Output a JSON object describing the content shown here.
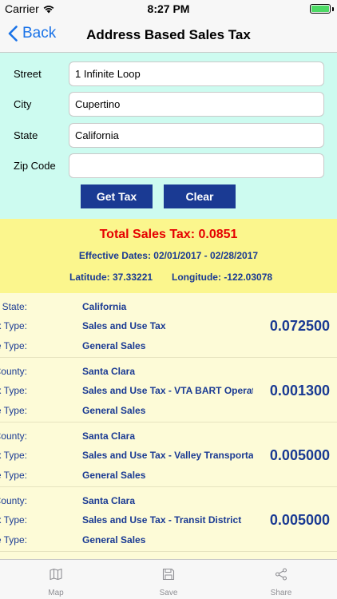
{
  "status_bar": {
    "carrier": "Carrier",
    "time": "8:27 PM"
  },
  "nav": {
    "back_label": "Back",
    "title": "Address Based Sales Tax"
  },
  "form": {
    "fields": [
      {
        "label": "Street",
        "value": "1 Infinite Loop"
      },
      {
        "label": "City",
        "value": "Cupertino"
      },
      {
        "label": "State",
        "value": "California"
      },
      {
        "label": "Zip Code",
        "value": ""
      }
    ],
    "get_tax_label": "Get Tax",
    "clear_label": "Clear"
  },
  "summary": {
    "total": "Total Sales Tax: 0.0851",
    "effective_dates": "Effective Dates: 02/01/2017 - 02/28/2017",
    "latitude": "Latitude: 37.33221",
    "longitude": "Longitude: -122.03078"
  },
  "entries": [
    {
      "jurisdiction_label": "State:",
      "jurisdiction": "California",
      "tax_type_label": "Tax Type:",
      "tax_type": "Sales and Use Tax",
      "rate_type_label": "Rate Type:",
      "rate_type": "General Sales",
      "rate": "0.072500"
    },
    {
      "jurisdiction_label": "County:",
      "jurisdiction": "Santa Clara",
      "tax_type_label": "Tax Type:",
      "tax_type": "Sales and Use Tax - VTA BART Operating",
      "rate_type_label": "Rate Type:",
      "rate_type": "General Sales",
      "rate": "0.001300"
    },
    {
      "jurisdiction_label": "County:",
      "jurisdiction": "Santa Clara",
      "tax_type_label": "Tax Type:",
      "tax_type": "Sales and Use Tax - Valley Transportation",
      "rate_type_label": "Rate Type:",
      "rate_type": "General Sales",
      "rate": "0.005000"
    },
    {
      "jurisdiction_label": "County:",
      "jurisdiction": "Santa Clara",
      "tax_type_label": "Tax Type:",
      "tax_type": "Sales and Use Tax - Transit District",
      "rate_type_label": "Rate Type:",
      "rate_type": "General Sales",
      "rate": "0.005000"
    }
  ],
  "tab_bar": {
    "tabs": [
      {
        "label": "Map",
        "icon": "map-icon"
      },
      {
        "label": "Save",
        "icon": "save-icon"
      },
      {
        "label": "Share",
        "icon": "share-icon"
      }
    ]
  },
  "colors": {
    "form_background": "#cdfbf0",
    "summary_background": "#fbf68d",
    "details_background": "#fdfbd7",
    "button": "#1a3a93",
    "total_text": "#e60000",
    "accent_text": "#1a3a93",
    "link": "#1a73e8",
    "battery": "#4cd964"
  },
  "battery_level": 1.0
}
